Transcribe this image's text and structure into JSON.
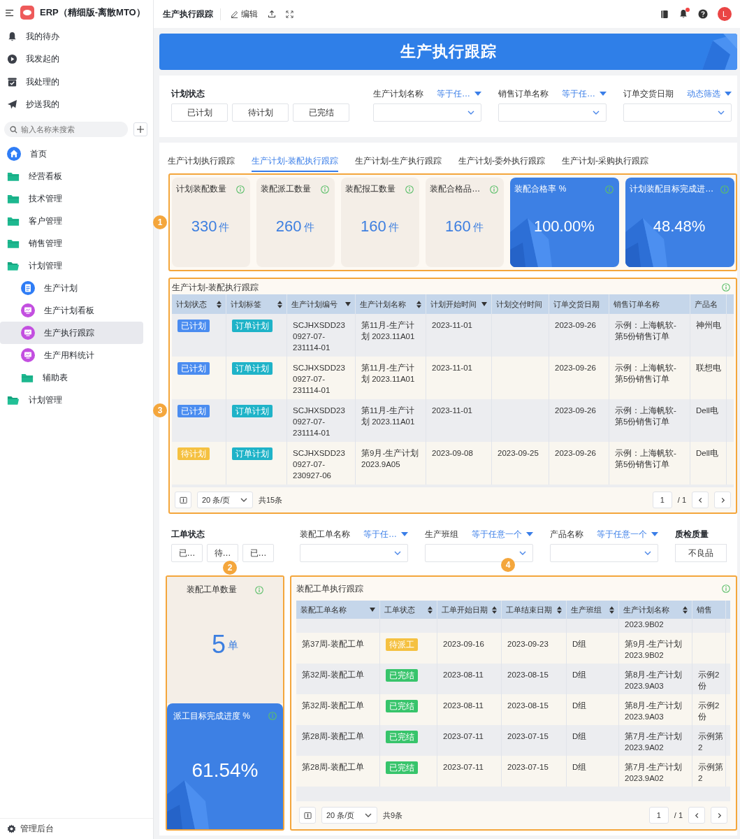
{
  "sidebar": {
    "title": "ERP（精细版-离散MTO）",
    "quick_items": [
      {
        "label": "我的待办",
        "kind": "bell"
      },
      {
        "label": "我发起的",
        "kind": "play"
      },
      {
        "label": "我处理的",
        "kind": "inbox"
      },
      {
        "label": "抄送我的",
        "kind": "send"
      }
    ],
    "search": {
      "placeholder": "输入名称来搜索"
    },
    "nav": [
      {
        "label": "首页",
        "kind": "home",
        "selected": false
      },
      {
        "label": "经营看板",
        "kind": "folder",
        "expanded": false,
        "selected": false
      },
      {
        "label": "技术管理",
        "kind": "folder",
        "expanded": false,
        "selected": false
      },
      {
        "label": "客户管理",
        "kind": "folder",
        "expanded": false,
        "selected": false
      },
      {
        "label": "销售管理",
        "kind": "folder",
        "expanded": false,
        "selected": false
      },
      {
        "label": "计划管理",
        "kind": "folder",
        "expanded": true,
        "selected": false,
        "children": [
          {
            "label": "生产计划",
            "kind": "doc",
            "selected": false
          },
          {
            "label": "生产计划看板",
            "kind": "board",
            "selected": false
          },
          {
            "label": "生产执行跟踪",
            "kind": "board",
            "selected": true
          },
          {
            "label": "生产用料统计",
            "kind": "board",
            "selected": false
          },
          {
            "label": "辅助表",
            "kind": "folder",
            "expanded": false,
            "selected": false
          }
        ]
      },
      {
        "label": "计划管理",
        "kind": "folder",
        "expanded": true,
        "selected": false
      }
    ],
    "footer": "管理后台"
  },
  "header": {
    "title": "生产执行跟踪",
    "edit": "编辑",
    "avatar": "L",
    "notification_dot": true
  },
  "banner": {
    "title": "生产执行跟踪"
  },
  "plan_filters": {
    "status": {
      "label": "计划状态",
      "options": [
        {
          "label": "已计划",
          "selected": false
        },
        {
          "label": "待计划",
          "selected": false
        },
        {
          "label": "已完结",
          "selected": false
        }
      ]
    },
    "fields": [
      {
        "label": "生产计划名称",
        "operator": "等于任…"
      },
      {
        "label": "销售订单名称",
        "operator": "等于任…"
      },
      {
        "label": "订单交货日期",
        "operator": "动态筛选"
      }
    ]
  },
  "tabs": [
    {
      "label": "生产计划执行跟踪",
      "selected": false
    },
    {
      "label": "生产计划-装配执行跟踪",
      "selected": true
    },
    {
      "label": "生产计划-生产执行跟踪",
      "selected": false
    },
    {
      "label": "生产计划-委外执行跟踪",
      "selected": false
    },
    {
      "label": "生产计划-采购执行跟踪",
      "selected": false
    }
  ],
  "kpis": [
    {
      "kind": "plain",
      "label": "计划装配数量",
      "value": "330",
      "unit": "件"
    },
    {
      "kind": "plain",
      "label": "装配派工数量",
      "value": "260",
      "unit": "件"
    },
    {
      "kind": "plain",
      "label": "装配报工数量",
      "value": "160",
      "unit": "件"
    },
    {
      "kind": "plain",
      "label": "装配合格品…",
      "value": "160",
      "unit": "件"
    },
    {
      "kind": "blue",
      "label": "装配合格率 %",
      "value": "100.00%"
    },
    {
      "kind": "blue",
      "label": "计划装配目标完成进…",
      "value": "48.48%"
    }
  ],
  "plan_table": {
    "title": "生产计划-装配执行跟踪",
    "columns": [
      {
        "label": "计划状态",
        "sortable": true,
        "dropdown": false
      },
      {
        "label": "计划标签",
        "sortable": true,
        "dropdown": false
      },
      {
        "label": "生产计划编号",
        "sortable": false,
        "dropdown": true
      },
      {
        "label": "生产计划名称",
        "sortable": true,
        "dropdown": false
      },
      {
        "label": "计划开始时间",
        "sortable": false,
        "dropdown": true
      },
      {
        "label": "计划交付时间",
        "sortable": false,
        "dropdown": false
      },
      {
        "label": "订单交货日期",
        "sortable": false,
        "dropdown": false
      },
      {
        "label": "销售订单名称",
        "sortable": false,
        "dropdown": false
      },
      {
        "label": "产品名",
        "sortable": false,
        "dropdown": false
      }
    ],
    "rows": [
      {
        "status": {
          "text": "已计划",
          "color": "#4a8cf0"
        },
        "tag": {
          "text": "订单计划",
          "color": "#1fb3c8"
        },
        "code": "SCJHXSDD230927-07-231114-01",
        "name": "第11月-生产计划 2023.11A01",
        "start": "2023-11-01",
        "order_date": "2023-09-26",
        "order_name": "示例：上海帆软-第5份销售订单",
        "product": "神州电"
      },
      {
        "status": {
          "text": "已计划",
          "color": "#4a8cf0"
        },
        "tag": {
          "text": "订单计划",
          "color": "#1fb3c8"
        },
        "code": "SCJHXSDD230927-07-231114-01",
        "name": "第11月-生产计划 2023.11A01",
        "start": "2023-11-01",
        "order_date": "2023-09-26",
        "order_name": "示例：上海帆软-第5份销售订单",
        "product": "联想电"
      },
      {
        "status": {
          "text": "已计划",
          "color": "#4a8cf0"
        },
        "tag": {
          "text": "订单计划",
          "color": "#1fb3c8"
        },
        "code": "SCJHXSDD230927-07-231114-01",
        "name": "第11月-生产计划 2023.11A01",
        "start": "2023-11-01",
        "order_date": "2023-09-26",
        "order_name": "示例：上海帆软-第5份销售订单",
        "product": "Dell电"
      },
      {
        "status": {
          "text": "待计划",
          "color": "#f5c141"
        },
        "tag": {
          "text": "订单计划",
          "color": "#1fb3c8"
        },
        "code": "SCJHXSDD230927-07-230927-06",
        "name": "第9月-生产计划 2023.9A05",
        "start": "2023-09-08",
        "delivery": "2023-09-25",
        "order_date": "2023-09-26",
        "order_name": "示例：上海帆软-第5份销售订单",
        "product": "Dell电"
      }
    ],
    "pagination": {
      "page_size": "20 条/页",
      "total": "共15条",
      "page": "1",
      "pages": "/ 1"
    }
  },
  "order_filters": {
    "status": {
      "label": "工单状态",
      "options": [
        {
          "label": "已…",
          "selected": false
        },
        {
          "label": "待…",
          "selected": false
        },
        {
          "label": "已…",
          "selected": false
        }
      ]
    },
    "fields": [
      {
        "label": "装配工单名称",
        "operator": "等于任…"
      },
      {
        "label": "生产班组",
        "operator": "等于任意一个"
      },
      {
        "label": "产品名称",
        "operator": "等于任意一个"
      }
    ],
    "quality": {
      "label": "质检质量",
      "option": "不良品"
    }
  },
  "order_kpis": [
    {
      "kind": "plain",
      "label": "装配工单数量",
      "value": "5",
      "unit": "单"
    },
    {
      "kind": "blue",
      "label": "派工目标完成进度 %",
      "value": "61.54%"
    }
  ],
  "order_table": {
    "title": "装配工单执行跟踪",
    "columns": [
      {
        "label": "装配工单名称",
        "sortable": false,
        "dropdown": true
      },
      {
        "label": "工单状态",
        "sortable": true,
        "dropdown": false
      },
      {
        "label": "工单开始日期",
        "sortable": true,
        "dropdown": false
      },
      {
        "label": "工单结束日期",
        "sortable": true,
        "dropdown": false
      },
      {
        "label": "生产班组",
        "sortable": true,
        "dropdown": false
      },
      {
        "label": "生产计划名称",
        "sortable": true,
        "dropdown": false
      },
      {
        "label": "销售",
        "sortable": false,
        "dropdown": false
      }
    ],
    "partial_row": {
      "plan_name": "2023.9B02"
    },
    "rows": [
      {
        "name": "第37周-装配工单",
        "status": {
          "text": "待派工",
          "color": "#f5c141"
        },
        "start": "2023-09-16",
        "end": "2023-09-23",
        "team": "D组",
        "plan_name": "第9月-生产计划 2023.9B02"
      },
      {
        "name": "第32周-装配工单",
        "status": {
          "text": "已完结",
          "color": "#37c46b"
        },
        "start": "2023-08-11",
        "end": "2023-08-15",
        "team": "D组",
        "plan_name": "第8月-生产计划 2023.9A03",
        "order": "示例2份"
      },
      {
        "name": "第32周-装配工单",
        "status": {
          "text": "已完结",
          "color": "#37c46b"
        },
        "start": "2023-08-11",
        "end": "2023-08-15",
        "team": "D组",
        "plan_name": "第8月-生产计划 2023.9A03",
        "order": "示例2份"
      },
      {
        "name": "第28周-装配工单",
        "status": {
          "text": "已完结",
          "color": "#37c46b"
        },
        "start": "2023-07-11",
        "end": "2023-07-15",
        "team": "D组",
        "plan_name": "第7月-生产计划 2023.9A02",
        "order": "示例第2"
      },
      {
        "name": "第28周-装配工单",
        "status": {
          "text": "已完结",
          "color": "#37c46b"
        },
        "start": "2023-07-11",
        "end": "2023-07-15",
        "team": "D组",
        "plan_name": "第7月-生产计划 2023.9A02",
        "order": "示例第2"
      }
    ],
    "pagination": {
      "page_size": "20 条/页",
      "total": "共9条",
      "page": "1",
      "pages": "/ 1"
    }
  },
  "annotations": [
    {
      "label": "1"
    },
    {
      "label": "3"
    },
    {
      "label": "2"
    },
    {
      "label": "4"
    }
  ]
}
